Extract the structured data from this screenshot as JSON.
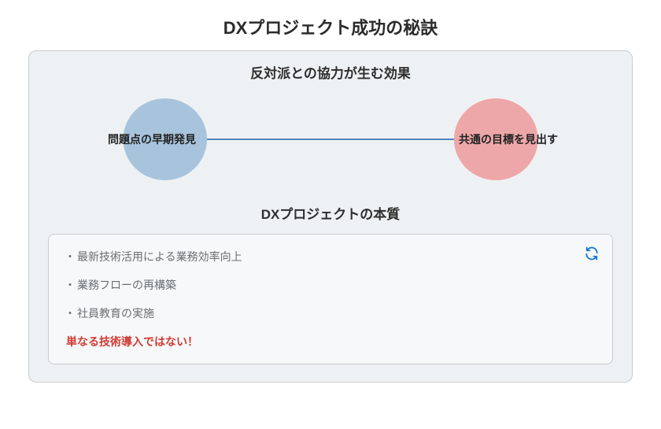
{
  "title": "DXプロジェクト成功の秘訣",
  "effect": {
    "heading": "反対派との協力が生む効果",
    "left_label": "問題点の早期発見",
    "right_label": "共通の目標を見出す",
    "left_color": "#a8c4dc",
    "right_color": "#eea7a8",
    "line_color": "#1f5fae"
  },
  "essence": {
    "heading": "DXプロジェクトの本質",
    "points": [
      "最新技術活用による業務効率向上",
      "業務フローの再構築",
      "社員教育の実施"
    ],
    "emphasis": "単なる技術導入ではない！",
    "refresh_icon": "refresh-icon"
  }
}
